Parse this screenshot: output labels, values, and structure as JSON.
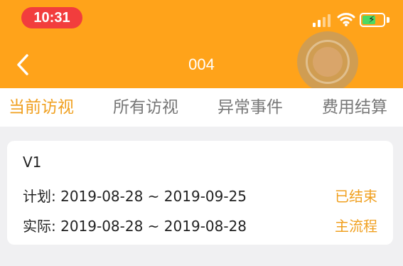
{
  "status_bar": {
    "time": "10:31"
  },
  "nav": {
    "title": "004"
  },
  "tabs": [
    {
      "label": "当前访视",
      "active": true
    },
    {
      "label": "所有访视",
      "active": false
    },
    {
      "label": "异常事件",
      "active": false
    },
    {
      "label": "费用结算",
      "active": false
    }
  ],
  "visit": {
    "name": "V1",
    "plan_text": "计划: 2019-08-28 ~ 2019-09-25",
    "plan_status": "已结束",
    "actual_text": "实际: 2019-08-28 ~ 2019-08-28",
    "actual_status": "主流程"
  },
  "colors": {
    "header": "#FFA31A",
    "accent": "#F0A020",
    "time_pill": "#F23D3D"
  },
  "icons": [
    "back-chevron-icon",
    "signal-icon",
    "wifi-icon",
    "battery-charging-icon"
  ]
}
